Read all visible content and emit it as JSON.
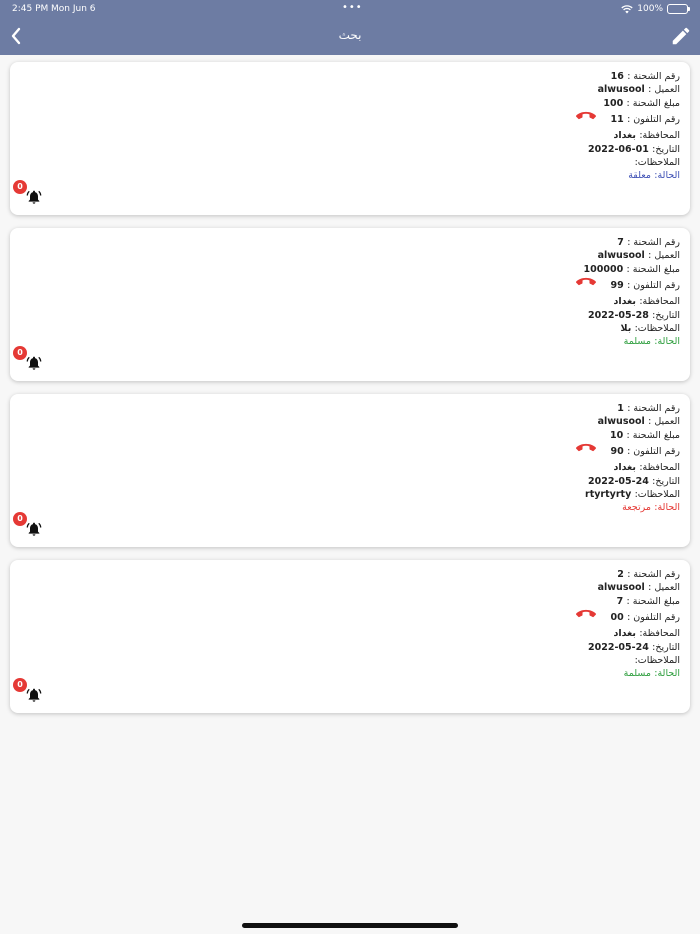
{
  "status_bar": {
    "time": "2:45 PM",
    "date": "Mon Jun 6",
    "battery": "100%",
    "battery_level": 1.0
  },
  "header": {
    "title": "بحث",
    "back_icon": "chevron-left-icon",
    "edit_icon": "pencil-icon",
    "bg_color": "#6d7ca3"
  },
  "cards": [
    {
      "shipment_label": "رقم الشحنة :",
      "shipment_no": "16",
      "client_label": "العميل :",
      "client": "alwusool",
      "amount_label": "مبلغ الشحنة :",
      "amount": "100",
      "phone_label": "رقم التلفون :",
      "phone": "11",
      "province_label": "المحافظة:",
      "province": "بغداد",
      "date_label": "التاريخ:",
      "date": "01-06-2022",
      "notes_label": "الملاحظات:",
      "notes": "",
      "status_label": "الحالة:",
      "status": "معلقة",
      "status_color": "#3f51b5",
      "badge": "0"
    },
    {
      "shipment_label": "رقم الشحنة :",
      "shipment_no": "7",
      "client_label": "العميل :",
      "client": "alwusool",
      "amount_label": "مبلغ الشحنة :",
      "amount": "100000",
      "phone_label": "رقم التلفون :",
      "phone": "99",
      "province_label": "المحافظة:",
      "province": "بغداد",
      "date_label": "التاريخ:",
      "date": "28-05-2022",
      "notes_label": "الملاحظات:",
      "notes": "بلا",
      "status_label": "الحالة:",
      "status": "مسلمة",
      "status_color": "#2e9e3e",
      "badge": "0"
    },
    {
      "shipment_label": "رقم الشحنة :",
      "shipment_no": "1",
      "client_label": "العميل :",
      "client": "alwusool",
      "amount_label": "مبلغ الشحنة :",
      "amount": "10",
      "phone_label": "رقم التلفون :",
      "phone": "90",
      "province_label": "المحافظة:",
      "province": "بغداد",
      "date_label": "التاريخ:",
      "date": "24-05-2022",
      "notes_label": "الملاحظات:",
      "notes": "rtyrtyrty",
      "status_label": "الحالة:",
      "status": "مرتجعة",
      "status_color": "#e53935",
      "badge": "0"
    },
    {
      "shipment_label": "رقم الشحنة :",
      "shipment_no": "2",
      "client_label": "العميل :",
      "client": "alwusool",
      "amount_label": "مبلغ الشحنة :",
      "amount": "7",
      "phone_label": "رقم التلفون :",
      "phone": "00",
      "province_label": "المحافظة:",
      "province": "بغداد",
      "date_label": "التاريخ:",
      "date": "24-05-2022",
      "notes_label": "الملاحظات:",
      "notes": "",
      "status_label": "الحالة:",
      "status": "مسلمة",
      "status_color": "#2e9e3e",
      "badge": "0"
    }
  ],
  "icons": {
    "phone": "phone-hangup-icon",
    "bell": "bell-icon",
    "phone_color": "#e53935"
  }
}
